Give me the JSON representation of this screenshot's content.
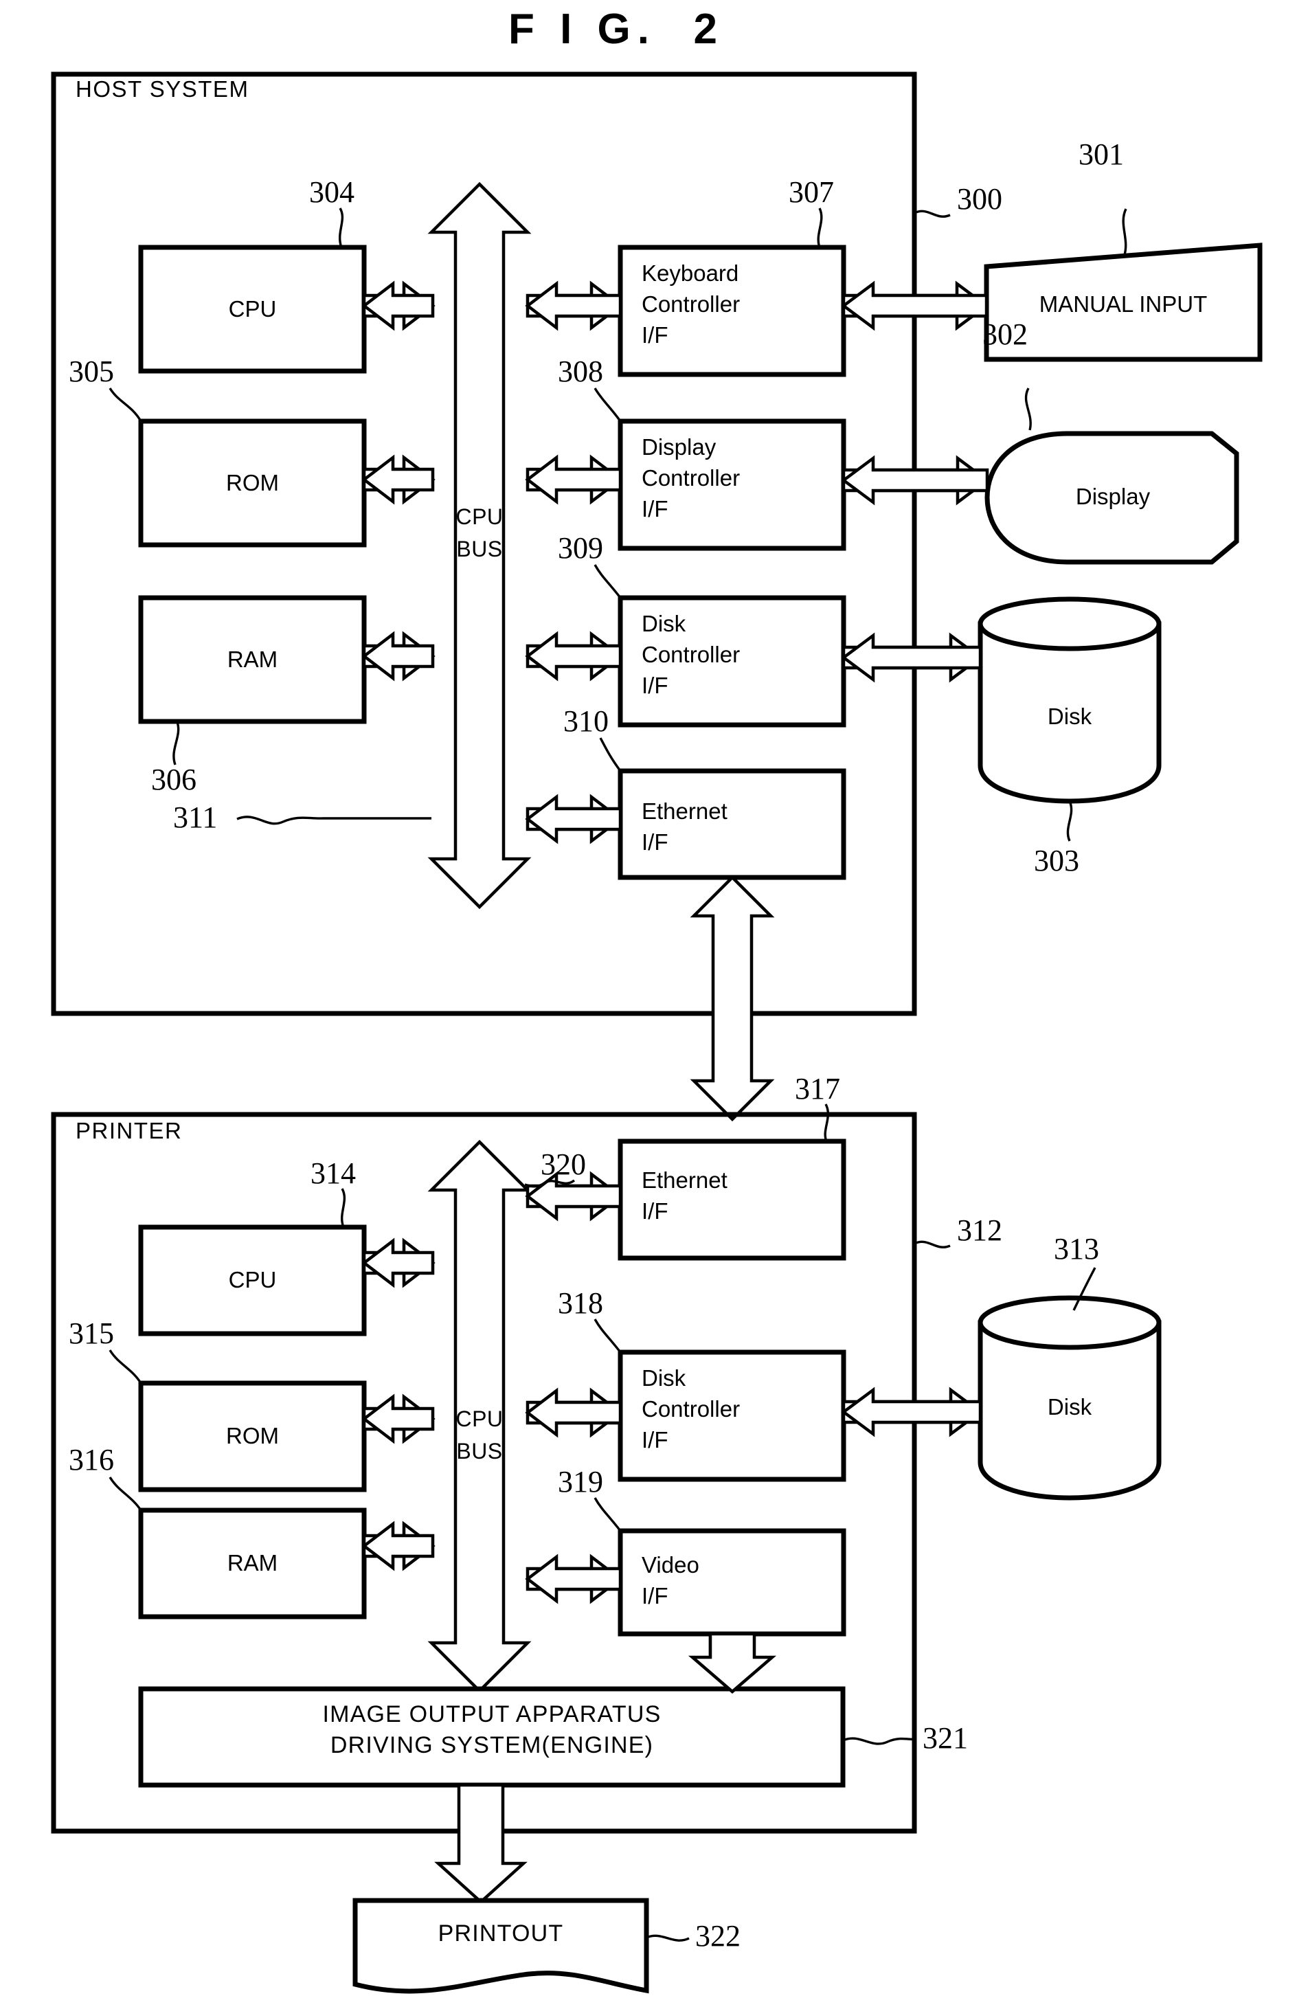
{
  "figure": {
    "title": "F I G.  2",
    "title_plain": "FIG. 2"
  },
  "host_system": {
    "section_label": "HOST SYSTEM",
    "ref": "300",
    "bus_label_line1": "CPU",
    "bus_label_line2": "BUS",
    "bus_ref": "311",
    "blocks": [
      {
        "id": "cpu",
        "label": "CPU",
        "ref": "304"
      },
      {
        "id": "rom",
        "label": "ROM",
        "ref": "305"
      },
      {
        "id": "ram",
        "label": "RAM",
        "ref": "306"
      },
      {
        "id": "keyboard_controller",
        "label": "Keyboard\nController\nI/F",
        "line1": "Keyboard",
        "line2": "Controller",
        "line3": "I/F",
        "ref": "307"
      },
      {
        "id": "display_controller",
        "label": "Display\nController\nI/F",
        "line1": "Display",
        "line2": "Controller",
        "line3": "I/F",
        "ref": "308"
      },
      {
        "id": "disk_controller",
        "label": "Disk\nController\nI/F",
        "line1": "Disk",
        "line2": "Controller",
        "line3": "I/F",
        "ref": "309"
      },
      {
        "id": "ethernet_if",
        "label": "Ethernet\nI/F",
        "line1": "Ethernet",
        "line2": "I/F",
        "ref": "310"
      }
    ],
    "peripherals": [
      {
        "id": "manual_input",
        "label": "MANUAL INPUT",
        "ref": "301",
        "shape": "trapezoid"
      },
      {
        "id": "display",
        "label": "Display",
        "ref": "302",
        "shape": "crt"
      },
      {
        "id": "disk",
        "label": "Disk",
        "ref": "303",
        "shape": "cylinder"
      }
    ]
  },
  "printer": {
    "section_label": "PRINTER",
    "ref": "312",
    "bus_label_line1": "CPU",
    "bus_label_line2": "BUS",
    "bus_ref": "320",
    "blocks": [
      {
        "id": "cpu",
        "label": "CPU",
        "ref": "314"
      },
      {
        "id": "rom",
        "label": "ROM",
        "ref": "315"
      },
      {
        "id": "ram",
        "label": "RAM",
        "ref": "316"
      },
      {
        "id": "ethernet_if",
        "label": "Ethernet\nI/F",
        "line1": "Ethernet",
        "line2": "I/F",
        "ref": "317"
      },
      {
        "id": "disk_controller",
        "label": "Disk\nController\nI/F",
        "line1": "Disk",
        "line2": "Controller",
        "line3": "I/F",
        "ref": "318"
      },
      {
        "id": "video_if",
        "label": "Video\nI/F",
        "line1": "Video",
        "line2": "I/F",
        "ref": "319"
      }
    ],
    "engine": {
      "id": "image_output_apparatus",
      "line1": "IMAGE OUTPUT APPARATUS",
      "line2": "DRIVING SYSTEM(ENGINE)",
      "ref": "321"
    },
    "peripherals": [
      {
        "id": "disk",
        "label": "Disk",
        "ref": "313",
        "shape": "cylinder"
      }
    ]
  },
  "output": {
    "id": "printout",
    "label": "PRINTOUT",
    "ref": "322",
    "shape": "document"
  },
  "colors": {
    "ink": "#000000",
    "paper": "#ffffff"
  }
}
